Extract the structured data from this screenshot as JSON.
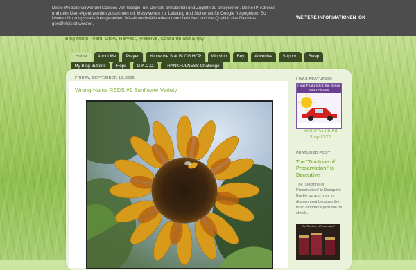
{
  "cookie": {
    "text": "Diese Website verwendet Cookies von Google, um Dienste anzubieten und Zugriffe zu analysieren. Deine IP-Adresse und dein User-Agent werden zusammen mit Messwerten zur Leistung und Sicherheit für Google freigegeben. So können Nutzungsstatistiken generiert, Missbrauchsfälle erkannt und behoben und die Qualität des Dienstes gewährleistet werden.",
    "more_info": "WEITERE INFORMATIONEN",
    "ok": "OK"
  },
  "blog": {
    "motto": "Blog Motto: Plant, Grow, Harvest, Preserve, Consume and Enjoy"
  },
  "nav": {
    "row1": [
      "Home",
      "About Me",
      "Prayer",
      "You're the Star BLOG HOP",
      "Worship",
      "Buy",
      "Advertise",
      "Support",
      "Swap"
    ],
    "row2": [
      "My Blog Buttons",
      "Hops",
      "G.K.C.C.",
      "THANKFULNESS Challenge"
    ]
  },
  "post": {
    "date": "FRIDAY, SEPTEMBER 12, 2025",
    "title": "Wrong-Name REDS #1 Sunflower Variety"
  },
  "sidebar": {
    "featured_header": "I WAS FEATURED!",
    "badge_line": "I was Featured on the Senior Salon Pit Stop",
    "badge_link": "Senior Salon Pit Stop #375",
    "featured_post_header": "FEATURED POST",
    "featured_title": "The \"Doctrine of Preservation\" is Deceptive",
    "featured_snippet": "The \"Doctrine of Preservation\" is Deceptive Buckle up and pray for discernment because the topic of today's post will be shock...",
    "featured_img_caption": "The \"Doctrine of Preservation\""
  },
  "colors": {
    "cookie_bg": "#4d4d4d",
    "tab_bg": "#3a4a24",
    "tab_active_bg": "#c7dfa0",
    "link_green": "#7fae3c"
  }
}
